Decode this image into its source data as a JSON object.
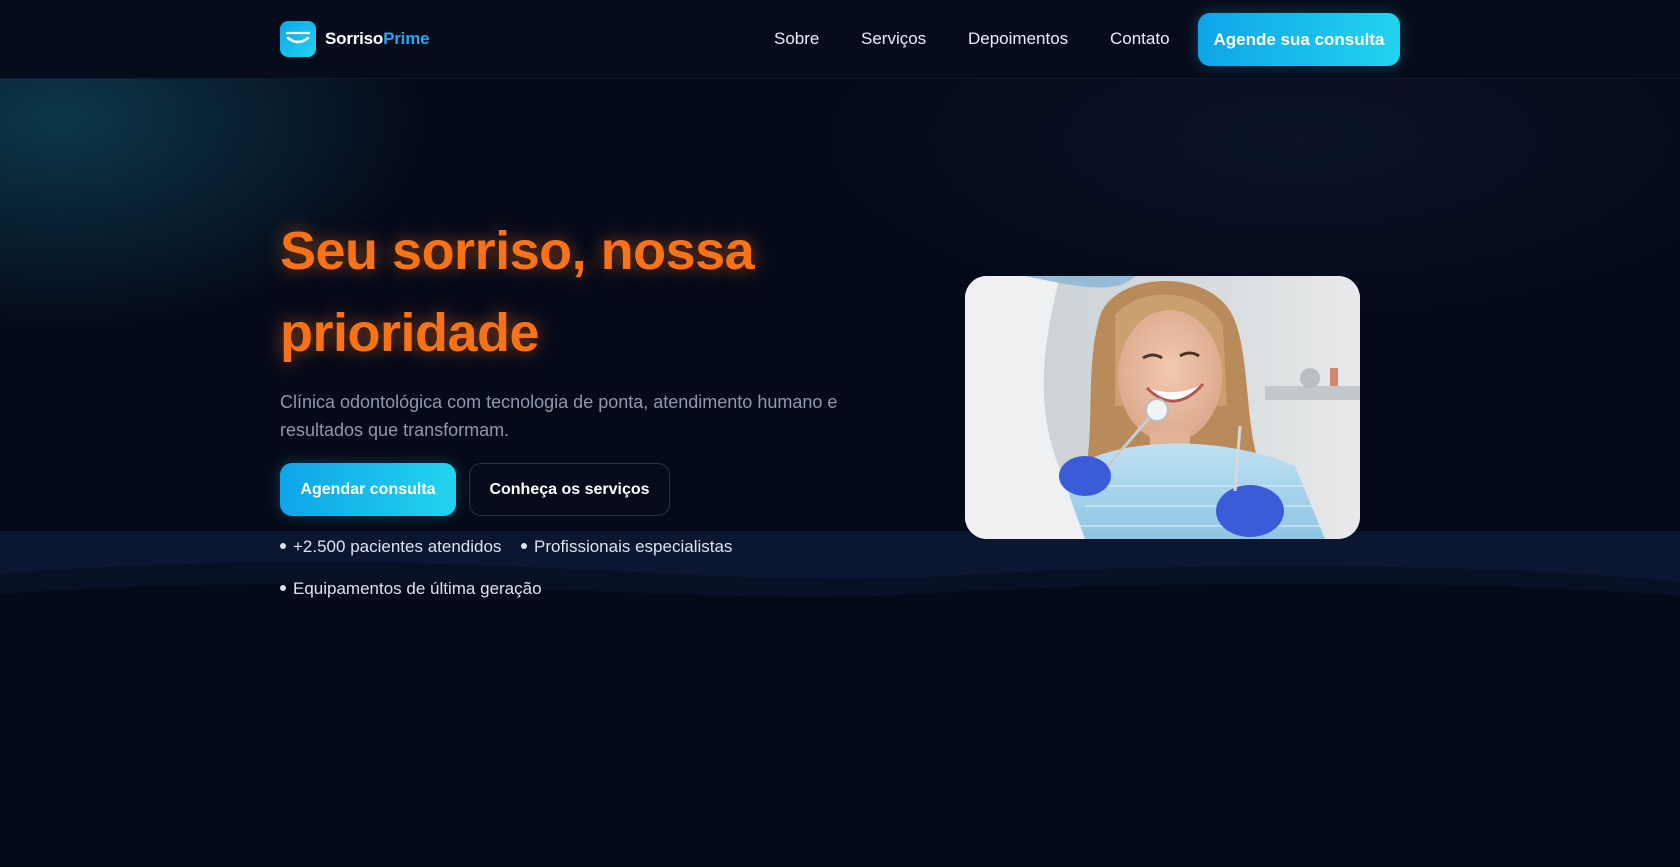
{
  "brand": {
    "name_part1": "Sorriso",
    "name_part2": "Prime",
    "logo_icon": "smile-icon"
  },
  "nav": {
    "links": [
      "Sobre",
      "Serviços",
      "Depoimentos",
      "Contato"
    ],
    "cta_label": "Agende sua consulta"
  },
  "hero": {
    "headline": "Seu sorriso, nossa prioridade",
    "subtitle": "Clínica odontológica com tecnologia de ponta, atendimento humano e resultados que transformam.",
    "primary_button": "Agendar consulta",
    "secondary_button": "Conheça os serviços",
    "features": [
      "+2.500 pacientes atendidos",
      "Profissionais especialistas",
      "Equipamentos de última geração"
    ],
    "image_icon": "patient-smiling-photo"
  },
  "colors": {
    "background": "#050a1a",
    "header": "#070c1c",
    "accent_orange": "#f97316",
    "accent_cyan_start": "#0ea5e9",
    "accent_cyan_end": "#22d3ee",
    "brand_blue": "#22a9f0"
  }
}
